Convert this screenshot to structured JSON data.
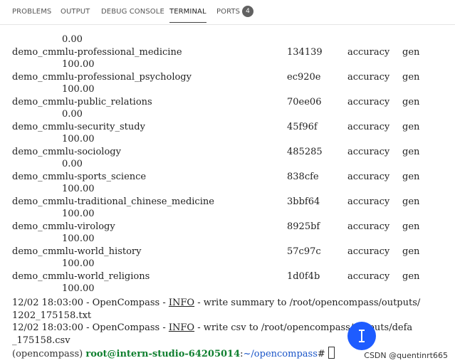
{
  "tabs": [
    {
      "label": "PROBLEMS"
    },
    {
      "label": "OUTPUT"
    },
    {
      "label": "DEBUG CONSOLE"
    },
    {
      "label": "TERMINAL"
    },
    {
      "label": "PORTS"
    }
  ],
  "ports_badge": "4",
  "terminal": {
    "first_value": "0.00",
    "rows": [
      {
        "name": "demo_cmmlu-professional_medicine",
        "version": "134139",
        "metric": "accuracy",
        "mode": "gen",
        "value": "100.00"
      },
      {
        "name": "demo_cmmlu-professional_psychology",
        "version": "ec920e",
        "metric": "accuracy",
        "mode": "gen",
        "value": "100.00"
      },
      {
        "name": "demo_cmmlu-public_relations",
        "version": "70ee06",
        "metric": "accuracy",
        "mode": "gen",
        "value": "0.00"
      },
      {
        "name": "demo_cmmlu-security_study",
        "version": "45f96f",
        "metric": "accuracy",
        "mode": "gen",
        "value": "100.00"
      },
      {
        "name": "demo_cmmlu-sociology",
        "version": "485285",
        "metric": "accuracy",
        "mode": "gen",
        "value": "0.00"
      },
      {
        "name": "demo_cmmlu-sports_science",
        "version": "838cfe",
        "metric": "accuracy",
        "mode": "gen",
        "value": "100.00"
      },
      {
        "name": "demo_cmmlu-traditional_chinese_medicine",
        "version": "3bbf64",
        "metric": "accuracy",
        "mode": "gen",
        "value": "100.00"
      },
      {
        "name": "demo_cmmlu-virology",
        "version": "8925bf",
        "metric": "accuracy",
        "mode": "gen",
        "value": "100.00"
      },
      {
        "name": "demo_cmmlu-world_history",
        "version": "57c97c",
        "metric": "accuracy",
        "mode": "gen",
        "value": "100.00"
      },
      {
        "name": "demo_cmmlu-world_religions",
        "version": "1d0f4b",
        "metric": "accuracy",
        "mode": "gen",
        "value": "100.00"
      }
    ],
    "log1": {
      "prefix": "12/02 18:03:00 - OpenCompass - ",
      "level": "INFO",
      "message": " - write summary to /root/opencompass/outputs/",
      "continuation": "1202_175158.txt"
    },
    "log2": {
      "prefix": "12/02 18:03:00 - OpenCompass - ",
      "level": "INFO",
      "message": " - write csv to /root/opencompass/outputs/defa",
      "continuation": "_175158.csv"
    },
    "prompt": {
      "env": "(opencompass) ",
      "user": "root@intern-studio-64205014",
      "colon": ":",
      "path": "~/opencompass",
      "symbol": "#"
    }
  },
  "watermark": "CSDN @quentinrt665",
  "colors": {
    "prompt_user": "#0f7f2f",
    "prompt_path": "#1a55c8",
    "mouse_highlight": "#1e5cff"
  }
}
